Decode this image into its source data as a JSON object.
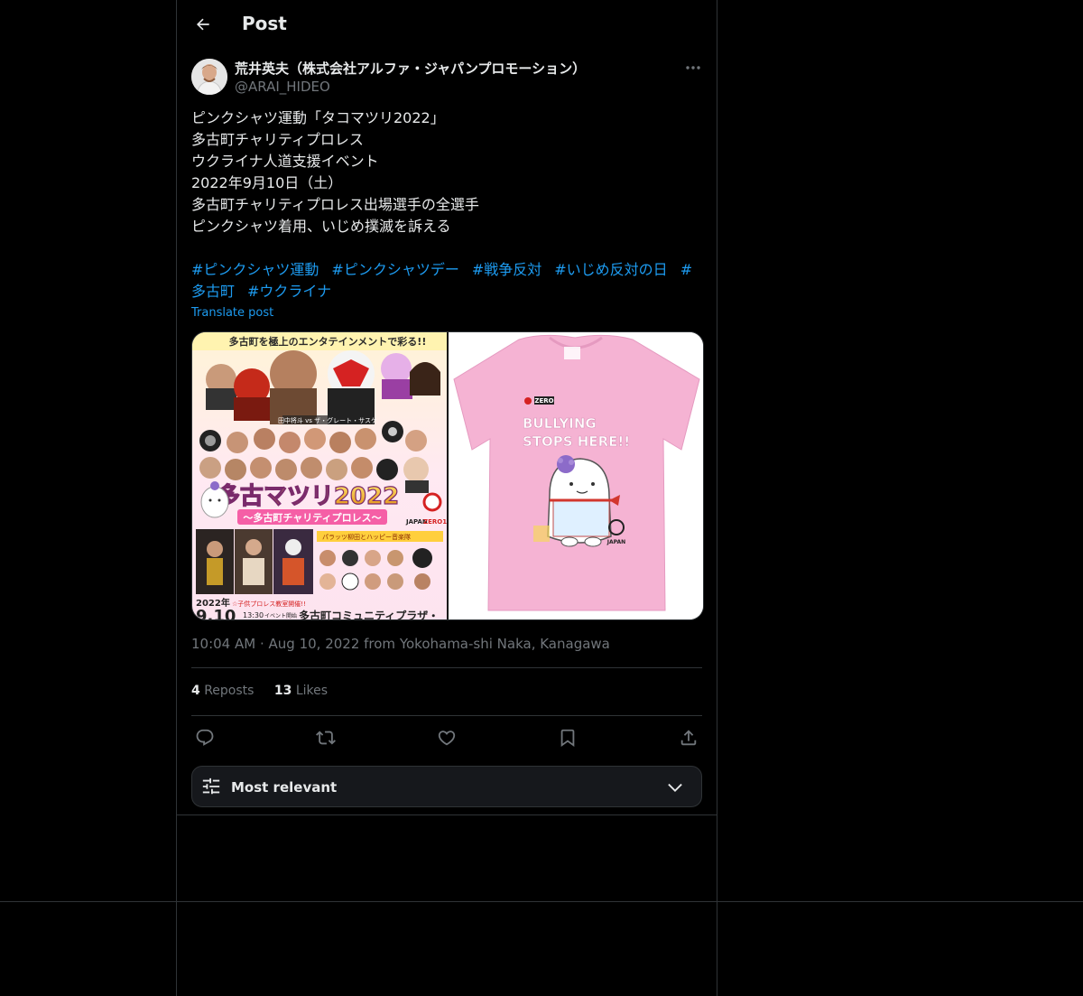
{
  "header": {
    "title": "Post"
  },
  "author": {
    "name": "荒井英夫（株式会社アルファ・ジャパンプロモーション）",
    "handle": "@ARAI_HIDEO"
  },
  "post": {
    "lines": [
      "ピンクシャツ運動「タコマツリ2022」",
      "多古町チャリティプロレス",
      "ウクライナ人道支援イベント",
      "2022年9月10日（土）",
      "多古町チャリティプロレス出場選手の全選手",
      "ピンクシャツ着用、いじめ撲滅を訴える"
    ],
    "hashtags": [
      "#ピンクシャツ運動",
      "#ピンクシャツデー",
      "#戦争反対",
      "#いじめ反対の日",
      "#多古町",
      "#ウクライナ"
    ],
    "translate_label": "Translate post"
  },
  "media": {
    "poster": {
      "banner": "多古町を極上のエンタテインメントで彩る!!",
      "title": "多古マツリ2022",
      "subtitle": "〜多古町チャリティプロレス〜",
      "date": "2022年",
      "date_big": "9.10",
      "time": "13:30",
      "event_start": "イベント開始",
      "venue": "多古町コミュニティプラザ・",
      "kids_note": "☆子供プロレス教室開催!!",
      "match_label": "田中将斗 vs ザ・グレート・サスケ",
      "zero_label": "ZERO1",
      "japan_label": "JAPAN"
    },
    "shirt": {
      "line1": "BULLYING",
      "line2": "STOPS HERE!!",
      "brand": "ZERO",
      "logo_text": "JAPAN"
    }
  },
  "meta": {
    "time": "10:04 AM",
    "separator": " · ",
    "date_location": "Aug 10, 2022 from Yokohama-shi Naka, Kanagawa"
  },
  "stats": {
    "reposts_count": "4",
    "reposts_label": "Reposts",
    "likes_count": "13",
    "likes_label": "Likes"
  },
  "sort": {
    "label": "Most relevant"
  },
  "colors": {
    "background": "#000000",
    "text": "#e7e9ea",
    "muted": "#71767b",
    "link": "#1d9bf0",
    "border": "#2f3336",
    "shirt_pink": "#f5b3d3"
  },
  "icons": [
    "arrow-left-icon",
    "more-dots-icon",
    "reply-icon",
    "repost-icon",
    "like-icon",
    "bookmark-icon",
    "share-icon",
    "sliders-icon",
    "chevron-down-icon"
  ]
}
